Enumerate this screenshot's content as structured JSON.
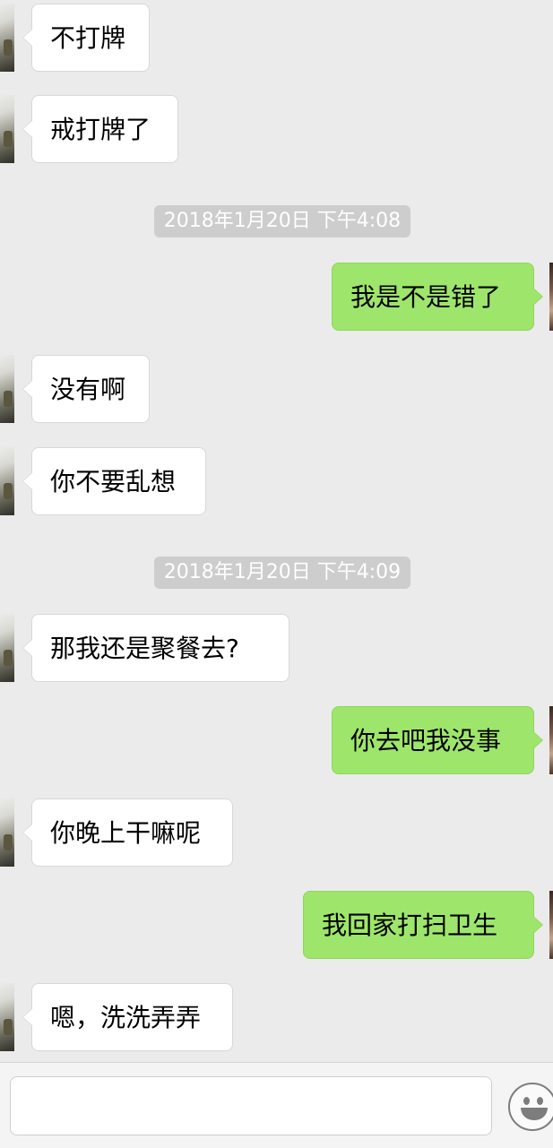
{
  "messages": [
    {
      "side": "in",
      "text": "不打牌"
    },
    {
      "side": "in",
      "text": "戒打牌了"
    },
    {
      "timestamp": "2018年1月20日 下午4:08"
    },
    {
      "side": "out",
      "text": "我是不是错了"
    },
    {
      "side": "in",
      "text": "没有啊"
    },
    {
      "side": "in",
      "text": "你不要乱想"
    },
    {
      "timestamp": "2018年1月20日 下午4:09"
    },
    {
      "side": "out",
      "text": "那我还是聚餐去?"
    },
    {
      "side": "out",
      "text": "你去吧我没事"
    },
    {
      "side": "in",
      "text": "你晚上干嘛呢"
    },
    {
      "side": "out",
      "text": "我回家打扫卫生"
    },
    {
      "side": "in",
      "text": "嗯，洗洗弄弄"
    }
  ],
  "input": {
    "value": ""
  },
  "icons": {
    "emoji_button": "smiley-face-icon"
  },
  "colors": {
    "background": "#ebebeb",
    "incoming_bubble": "#ffffff",
    "outgoing_bubble": "#9ee66b",
    "timestamp_bg": "#cdcdcd"
  }
}
